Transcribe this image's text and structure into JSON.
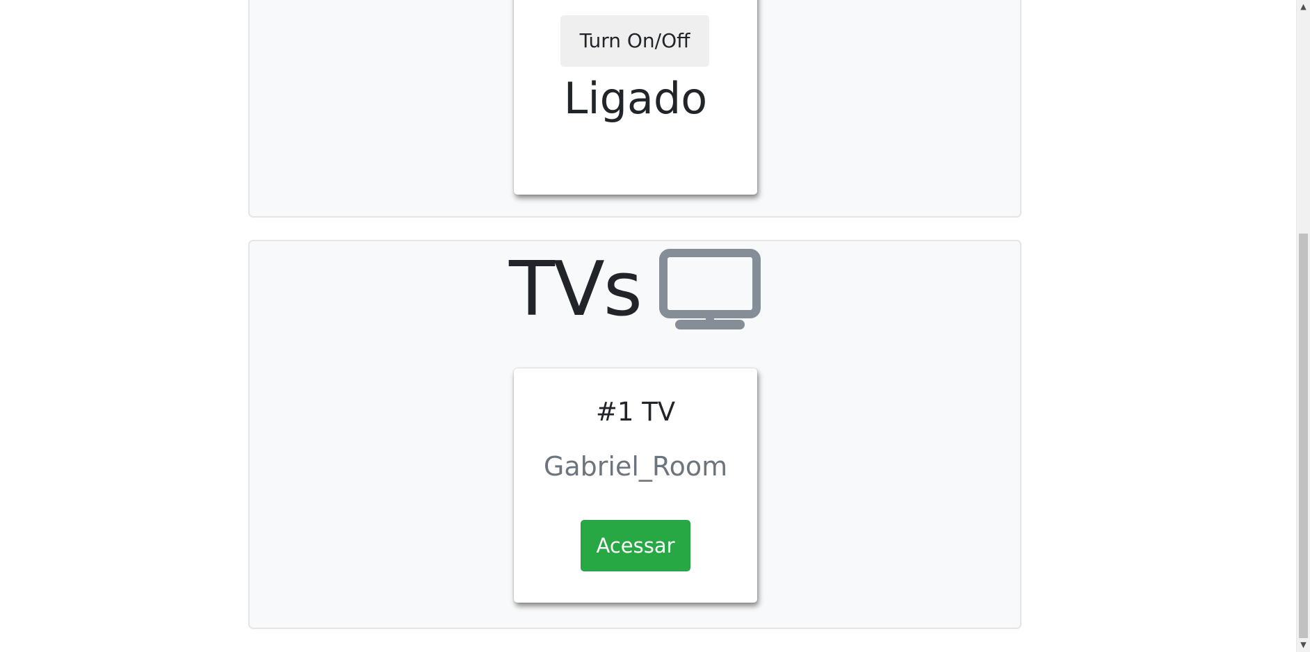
{
  "lights_section": {
    "card": {
      "button_label": "Turn On/Off",
      "status": "Ligado"
    }
  },
  "tvs_section": {
    "heading": "TVs",
    "heading_icon": "tv-monitor-icon",
    "cards": [
      {
        "title": "#1 TV",
        "room": "Gabriel_Room",
        "button_label": "Acessar"
      }
    ]
  },
  "colors": {
    "section_bg": "#f8f9fa",
    "icon_gray": "#858d96",
    "success_green": "#28a745",
    "muted_text": "#6c757d"
  },
  "scrollbar": {
    "up_icon": "scroll-up-arrow-icon",
    "down_icon": "scroll-down-arrow-icon"
  }
}
